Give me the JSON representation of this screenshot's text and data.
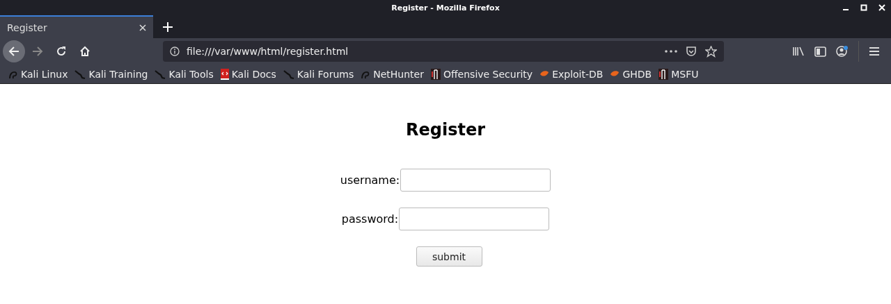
{
  "window": {
    "title": "Register - Mozilla Firefox"
  },
  "tabs": [
    {
      "label": "Register",
      "selected": true
    }
  ],
  "nav_buttons": [
    {
      "kind": "back",
      "disabled": false
    },
    {
      "kind": "forward",
      "disabled": true
    },
    {
      "kind": "reload",
      "disabled": false
    },
    {
      "kind": "home",
      "disabled": false
    }
  ],
  "address_bar": {
    "value": "file:///var/www/html/register.html"
  },
  "bookmarks": [
    {
      "label": "Kali Linux",
      "kind": "kali"
    },
    {
      "label": "Kali Training",
      "kind": "dragon"
    },
    {
      "label": "Kali Tools",
      "kind": "dragon"
    },
    {
      "label": "Kali Docs",
      "kind": "docs"
    },
    {
      "label": "Kali Forums",
      "kind": "dragon"
    },
    {
      "label": "NetHunter",
      "kind": "kali"
    },
    {
      "label": "Offensive Security",
      "kind": "offsec"
    },
    {
      "label": "Exploit-DB",
      "kind": "exploit"
    },
    {
      "label": "GHDB",
      "kind": "exploit"
    },
    {
      "label": "MSFU",
      "kind": "offsec"
    }
  ],
  "page": {
    "heading": "Register",
    "fields": [
      {
        "label": "username:"
      },
      {
        "label": "password:"
      }
    ],
    "submit": "submit"
  }
}
